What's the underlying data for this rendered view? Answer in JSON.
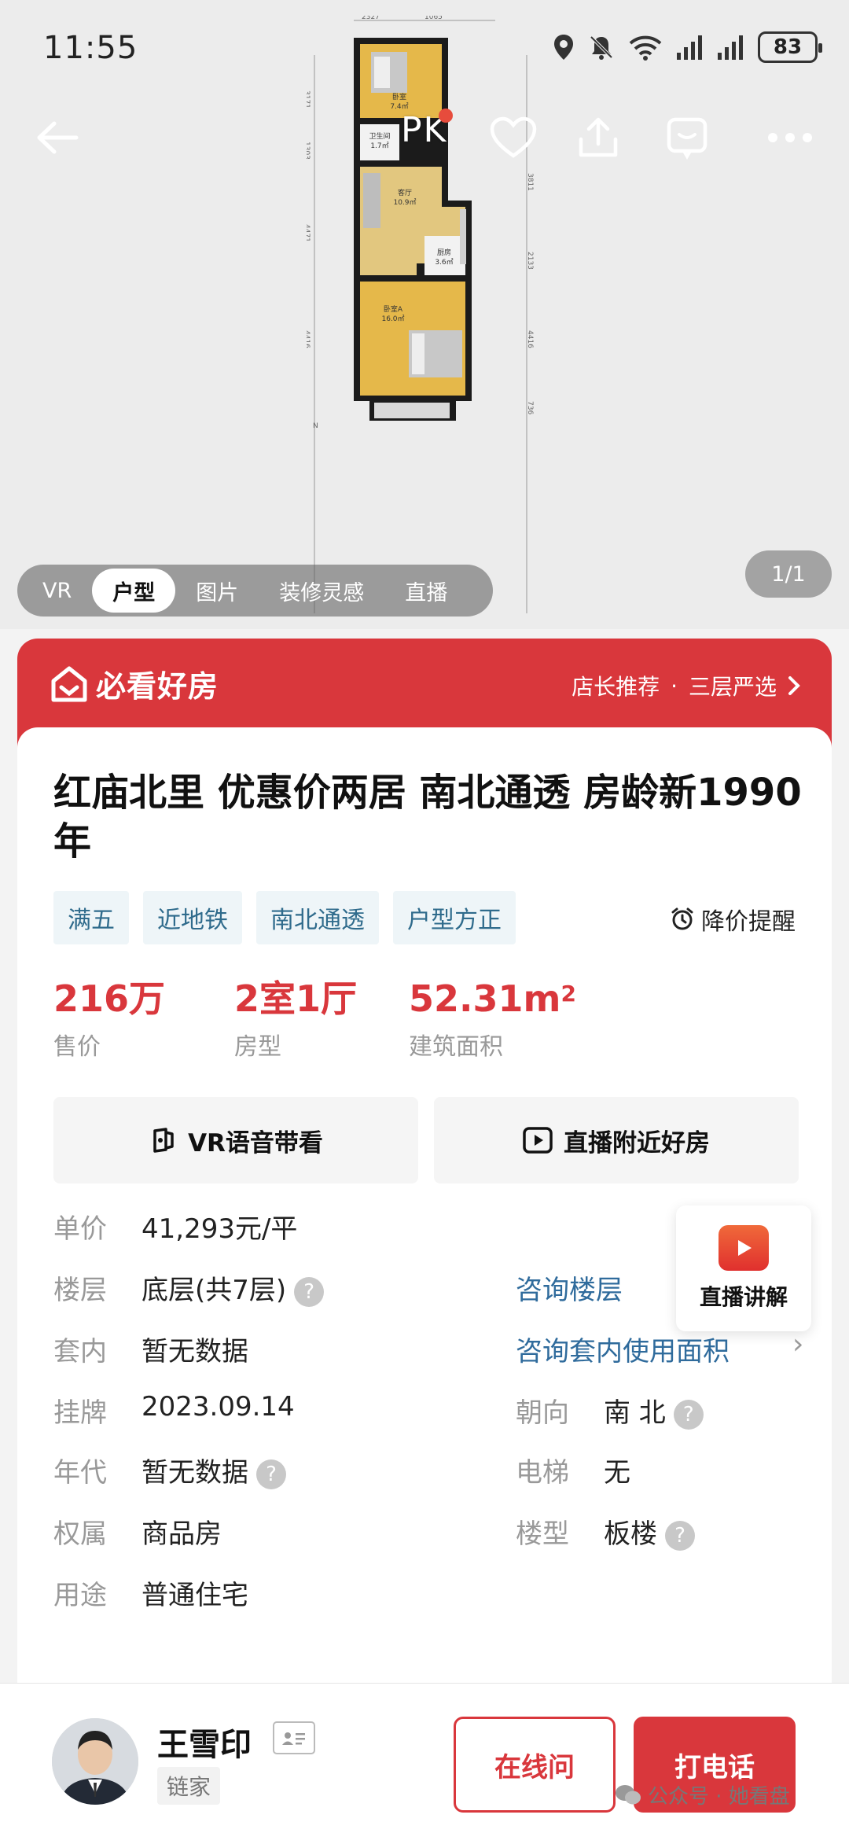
{
  "status_bar": {
    "time": "11:55",
    "battery": "83"
  },
  "hero": {
    "pk_label": "PK",
    "plan": {
      "dims_top": [
        "2327",
        "1065"
      ],
      "dims_left": [
        "3171",
        "1303",
        "4471",
        "4416"
      ],
      "dims_right": [
        "3811",
        "2133",
        "4416",
        "736"
      ],
      "north": "N",
      "rooms": [
        {
          "name": "卧室",
          "area": "7.4㎡"
        },
        {
          "name": "卫生间",
          "area": "1.7㎡"
        },
        {
          "name": "客厅",
          "area": "10.9㎡"
        },
        {
          "name": "厨房",
          "area": "3.6㎡"
        },
        {
          "name": "卧室A",
          "area": "16.0㎡"
        }
      ]
    },
    "tabs": [
      {
        "label": "VR"
      },
      {
        "label": "户型"
      },
      {
        "label": "图片"
      },
      {
        "label": "装修灵感"
      },
      {
        "label": "直播"
      }
    ],
    "page_counter": "1/1"
  },
  "banner": {
    "brand": "必看好房",
    "right_text_1": "店长推荐",
    "separator": "·",
    "right_text_2": "三层严选"
  },
  "listing": {
    "title": "红庙北里 优惠价两居 南北通透 房龄新1990年",
    "tags": [
      "满五",
      "近地铁",
      "南北通透",
      "户型方正"
    ],
    "price_alert": "降价提醒",
    "stats": {
      "price": {
        "value": "216万",
        "label": "售价"
      },
      "layout": {
        "value": "2室1厅",
        "label": "房型"
      },
      "area": {
        "value": "52.31m",
        "sup": "2",
        "label": "建筑面积"
      }
    },
    "actions": {
      "vr": "VR语音带看",
      "live": "直播附近好房"
    },
    "live_float": "直播讲解",
    "details": {
      "unit_price": {
        "label": "单价",
        "value": "41,293元/平"
      },
      "floor": {
        "label": "楼层",
        "value": "底层(共7层)",
        "link": "咨询楼层"
      },
      "inner": {
        "label": "套内",
        "value": "暂无数据",
        "link": "咨询套内使用面积"
      },
      "listed": {
        "label": "挂牌",
        "value": "2023.09.14"
      },
      "orientation": {
        "label": "朝向",
        "value": "南 北"
      },
      "year": {
        "label": "年代",
        "value": "暂无数据"
      },
      "elevator": {
        "label": "电梯",
        "value": "无"
      },
      "ownership": {
        "label": "权属",
        "value": "商品房"
      },
      "building_type": {
        "label": "楼型",
        "value": "板楼"
      },
      "usage": {
        "label": "用途",
        "value": "普通住宅"
      }
    }
  },
  "agent": {
    "name": "王雪印",
    "agency": "链家",
    "chat_label": "在线问",
    "call_label": "打电话"
  },
  "watermark": "公众号 · 她看盘",
  "colors": {
    "accent": "#d9373c",
    "link": "#2f6b9c",
    "tag_bg": "#eef5f8"
  }
}
